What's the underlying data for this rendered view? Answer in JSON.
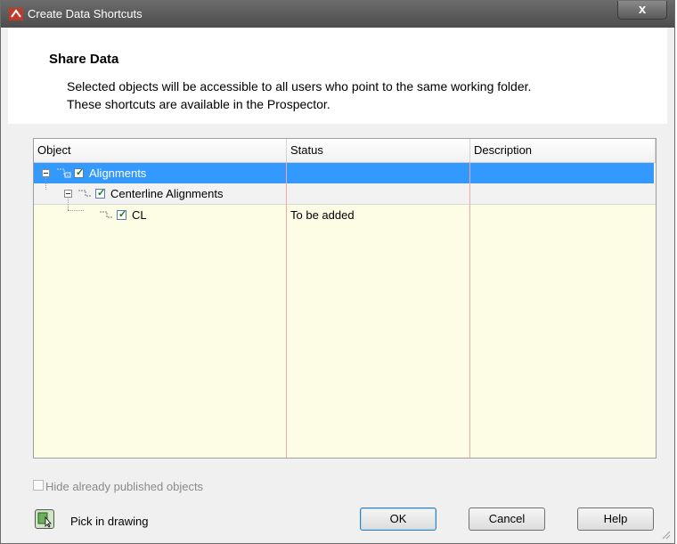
{
  "window": {
    "title": "Create Data Shortcuts",
    "close_label": "x"
  },
  "header": {
    "title": "Share Data",
    "line1": "Selected objects will be accessible to all users who point to the same working folder.",
    "line2": "These shortcuts are available in the Prospector."
  },
  "grid": {
    "columns": [
      "Object",
      "Status",
      "Description"
    ],
    "rows": [
      {
        "label": "Alignments",
        "status": "",
        "description": "",
        "checked": true,
        "selected": true,
        "level": 0
      },
      {
        "label": "Centerline Alignments",
        "status": "",
        "description": "",
        "checked": true,
        "selected": false,
        "level": 1
      },
      {
        "label": "CL",
        "status": "To be added",
        "description": "",
        "checked": true,
        "selected": false,
        "level": 2
      }
    ]
  },
  "footer": {
    "hide_published_label": "Hide already published objects",
    "hide_published_checked": false,
    "pick_label": "Pick in drawing",
    "ok_label": "OK",
    "cancel_label": "Cancel",
    "help_label": "Help"
  },
  "colors": {
    "selection": "#3399ff",
    "grid_background": "#fdfde6",
    "column_divider": "#f2a8a8"
  }
}
